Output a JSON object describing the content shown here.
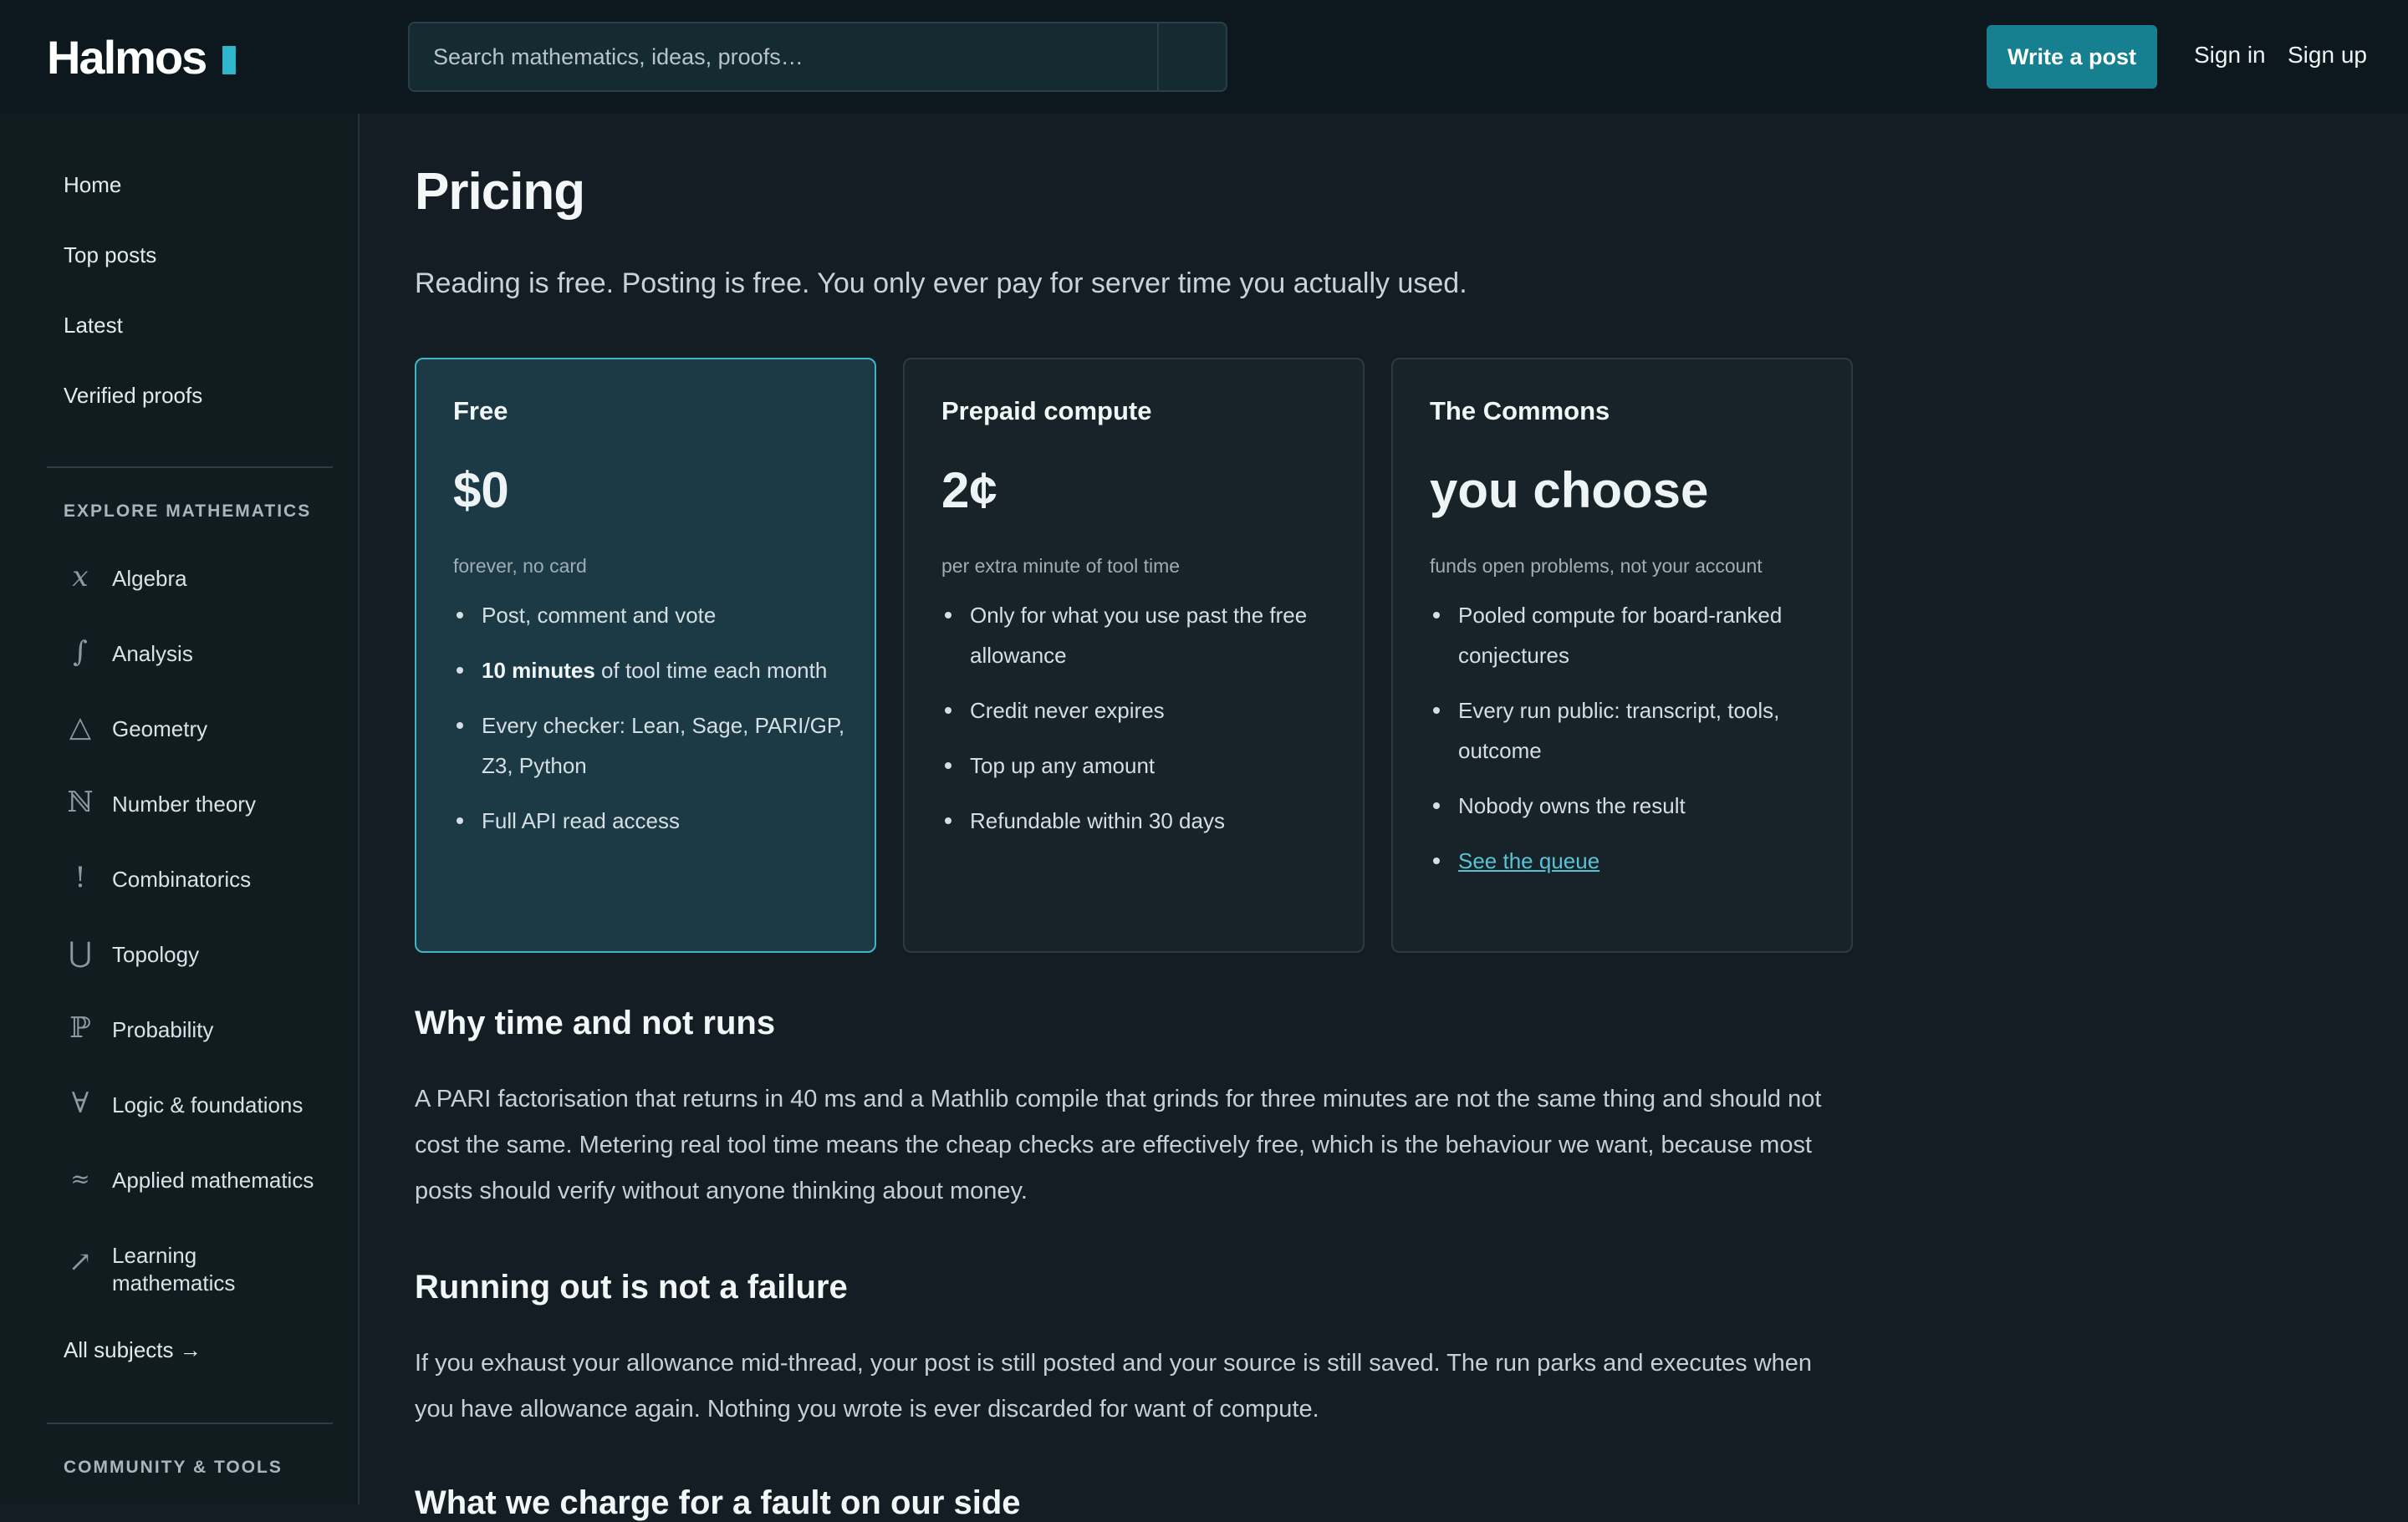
{
  "header": {
    "brand": "Halmos",
    "search_placeholder": "Search mathematics, ideas, proofs…",
    "write_label": "Write a post",
    "signin_label": "Sign in",
    "signup_label": "Sign up"
  },
  "sidebar": {
    "nav": [
      "Home",
      "Top posts",
      "Latest",
      "Verified proofs"
    ],
    "explore_heading": "EXPLORE MATHEMATICS",
    "subjects": [
      {
        "icon": "x",
        "label": "Algebra"
      },
      {
        "icon": "∫",
        "label": "Analysis"
      },
      {
        "icon": "△",
        "label": "Geometry"
      },
      {
        "icon": "ℕ",
        "label": "Number theory"
      },
      {
        "icon": "!",
        "label": "Combinatorics"
      },
      {
        "icon": "⋃",
        "label": "Topology"
      },
      {
        "icon": "ℙ",
        "label": "Probability"
      },
      {
        "icon": "∀",
        "label": "Logic & foundations"
      },
      {
        "icon": "≈",
        "label": "Applied mathematics"
      },
      {
        "icon": "↗",
        "label": "Learning mathematics"
      }
    ],
    "all_subjects": "All subjects →",
    "community_heading": "COMMUNITY & TOOLS"
  },
  "main": {
    "title": "Pricing",
    "lead": "Reading is free. Posting is free. You only ever pay for server time you actually used.",
    "plans": [
      {
        "name": "Free",
        "price": "$0",
        "note": "forever, no card",
        "items": [
          "Post, comment and vote",
          {
            "bold": "10 minutes",
            "rest": " of tool time each month"
          },
          "Every checker: Lean, Sage, PARI/GP, Z3, Python",
          "Full API read access"
        ]
      },
      {
        "name": "Prepaid compute",
        "price": "2¢",
        "note": "per extra minute of tool time",
        "items": [
          "Only for what you use past the free allowance",
          "Credit never expires",
          "Top up any amount",
          "Refundable within 30 days"
        ]
      },
      {
        "name": "The Commons",
        "price": "you choose",
        "note": "funds open problems, not your account",
        "items": [
          "Pooled compute for board-ranked conjectures",
          "Every run public: transcript, tools, outcome",
          "Nobody owns the result"
        ],
        "link": "See the queue"
      }
    ],
    "sections": [
      {
        "heading": "Why time and not runs",
        "text": "A PARI factorisation that returns in 40 ms and a Mathlib compile that grinds for three minutes are not the same thing and should not cost the same. Metering real tool time means the cheap checks are effectively free, which is the behaviour we want, because most posts should verify without anyone thinking about money."
      },
      {
        "heading": "Running out is not a failure",
        "text": "If you exhaust your allowance mid-thread, your post is still posted and your source is still saved. The run parks and executes when you have allowance again. Nothing you wrote is ever discarded for want of compute."
      },
      {
        "heading": "What we charge for a fault on our side"
      }
    ]
  }
}
